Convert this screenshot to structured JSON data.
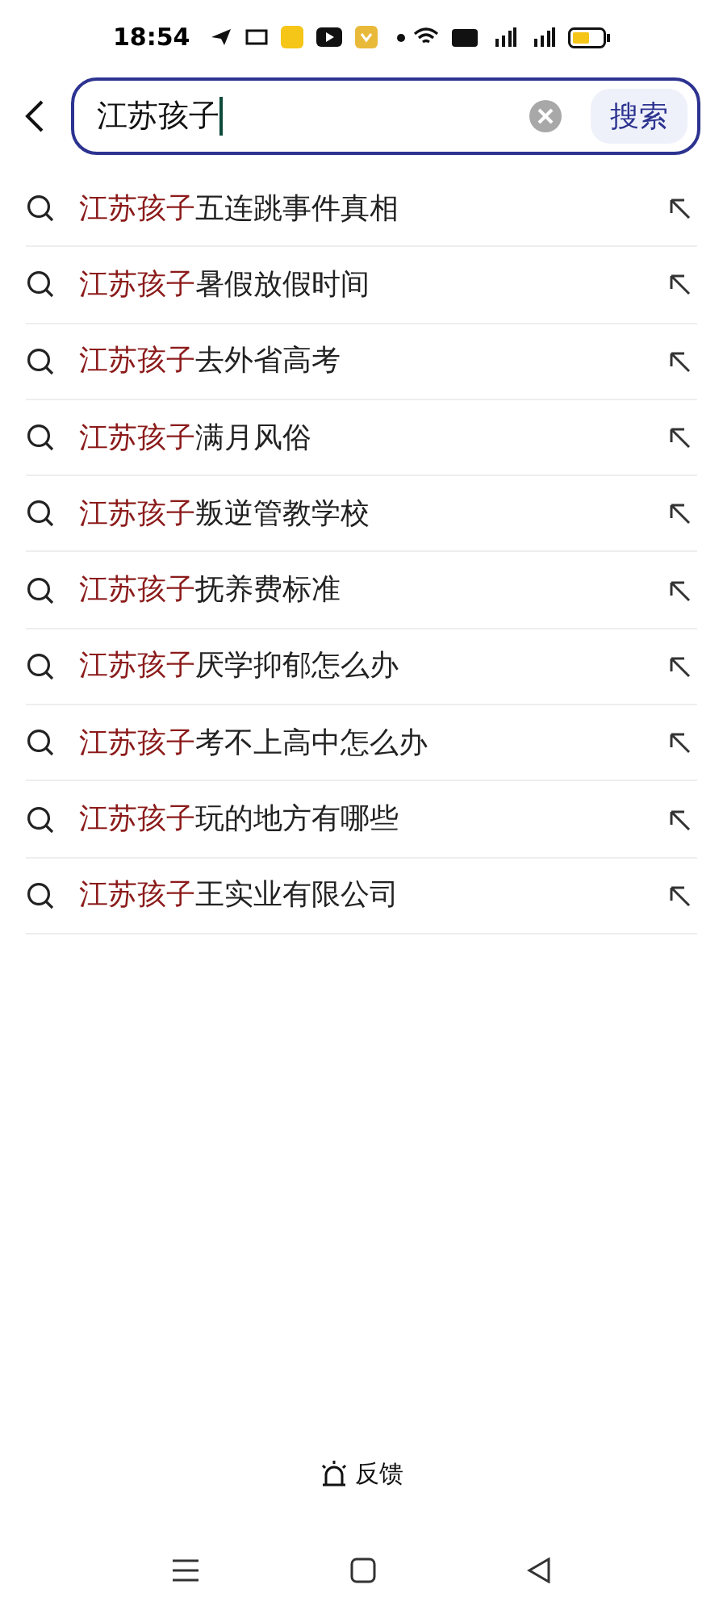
{
  "status_bar": {
    "time": "18:54"
  },
  "search": {
    "value": "江苏孩子",
    "button": "搜索"
  },
  "suggestions": [
    {
      "match": "江苏孩子",
      "rest": "五连跳事件真相"
    },
    {
      "match": "江苏孩子",
      "rest": "暑假放假时间"
    },
    {
      "match": "江苏孩子",
      "rest": "去外省高考"
    },
    {
      "match": "江苏孩子",
      "rest": "满月风俗"
    },
    {
      "match": "江苏孩子",
      "rest": "叛逆管教学校"
    },
    {
      "match": "江苏孩子",
      "rest": "抚养费标准"
    },
    {
      "match": "江苏孩子",
      "rest": "厌学抑郁怎么办"
    },
    {
      "match": "江苏孩子",
      "rest": "考不上高中怎么办"
    },
    {
      "match": "江苏孩子",
      "rest": "玩的地方有哪些"
    },
    {
      "match": "江苏孩子",
      "rest": "王实业有限公司"
    }
  ],
  "feedback": "反馈"
}
